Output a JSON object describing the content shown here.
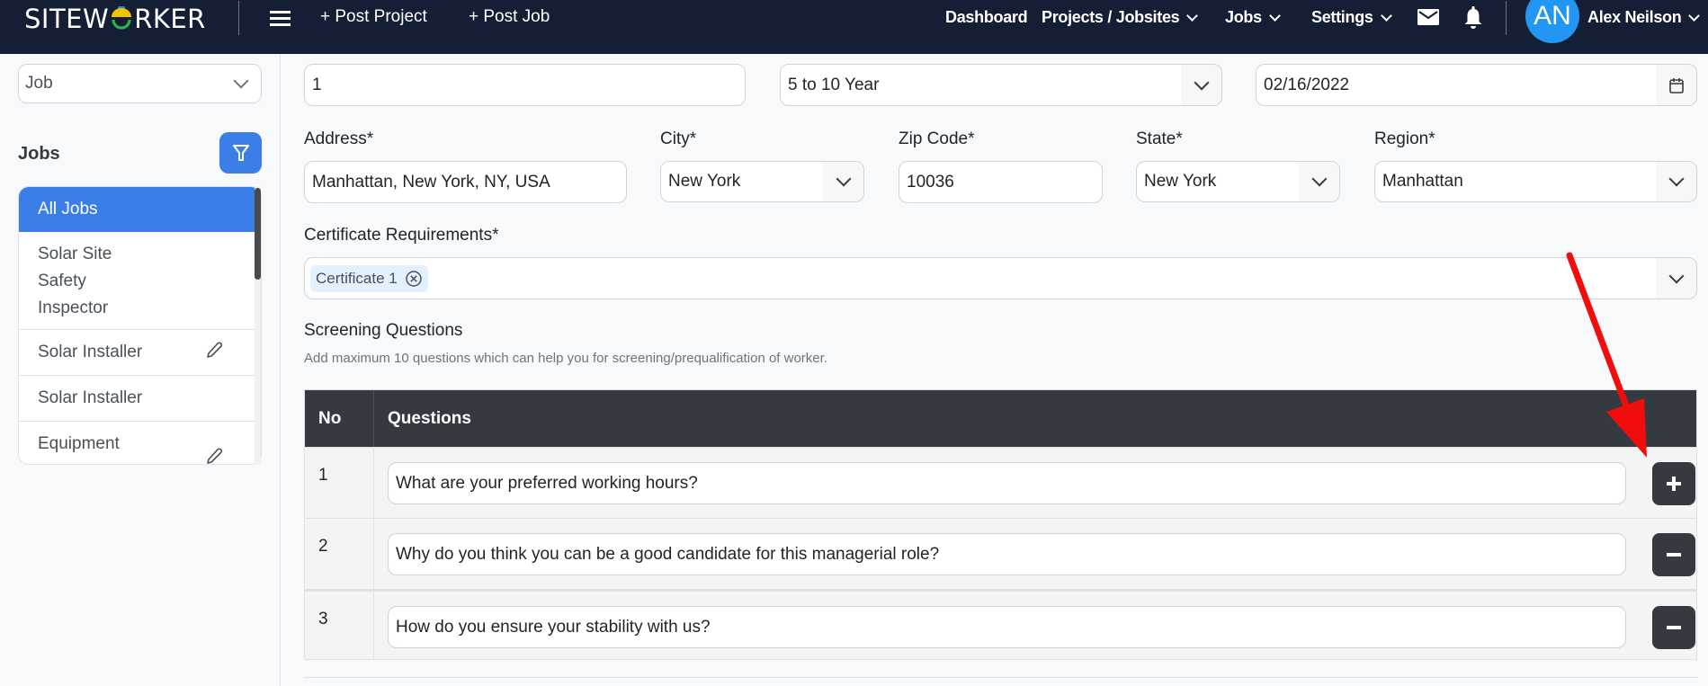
{
  "header": {
    "logo_text_before": "SITEW",
    "logo_text_after": "RKER",
    "menu_icon": "hamburger-icon",
    "post_project": "+ Post Project",
    "post_job": "+ Post Job",
    "nav": {
      "dashboard": "Dashboard",
      "projects": "Projects / Jobsites",
      "jobs": "Jobs",
      "settings": "Settings"
    },
    "mail_icon": "mail-icon",
    "bell_icon": "bell-icon",
    "user": {
      "initials": "AN",
      "name": "Alex Neilson"
    }
  },
  "sidebar": {
    "type_select": "Job",
    "jobs_title": "Jobs",
    "filter_icon": "filter-icon",
    "jobs": [
      {
        "label": "All Jobs",
        "active": true,
        "editable": false
      },
      {
        "label_lines": [
          "Solar Site",
          "Safety",
          "Inspector"
        ],
        "active": false,
        "editable": false
      },
      {
        "label": "Solar Installer",
        "active": false,
        "editable": true
      },
      {
        "label": "Solar Installer",
        "active": false,
        "editable": false
      },
      {
        "label": "Equipment",
        "active": false,
        "editable": true
      }
    ]
  },
  "form": {
    "top_row": {
      "number_value": "1",
      "experience_value": "5 to 10 Year",
      "date_value": "02/16/2022"
    },
    "address": {
      "label": "Address*",
      "value": "Manhattan, New York, NY, USA"
    },
    "city": {
      "label": "City*",
      "value": "New York"
    },
    "zip": {
      "label": "Zip Code*",
      "value": "10036"
    },
    "state": {
      "label": "State*",
      "value": "New York"
    },
    "region": {
      "label": "Region*",
      "value": "Manhattan"
    },
    "certificates": {
      "label": "Certificate Requirements*",
      "selected": [
        "Certificate 1"
      ]
    },
    "screening": {
      "title": "Screening Questions",
      "hint": "Add maximum 10 questions which can help you for screening/prequalification of worker.",
      "columns": [
        "No",
        "Questions"
      ],
      "rows": [
        {
          "no": "1",
          "question": "What are your preferred working hours?",
          "action": "add"
        },
        {
          "no": "2",
          "question": "Why do you think you can be a good candidate for this managerial role?",
          "action": "remove"
        },
        {
          "no": "3",
          "question": "How do you ensure your stability with us?",
          "action": "remove"
        }
      ]
    }
  },
  "annotation": {
    "type": "red-arrow",
    "color": "#f20d0d",
    "points_to": "add-question-button"
  }
}
